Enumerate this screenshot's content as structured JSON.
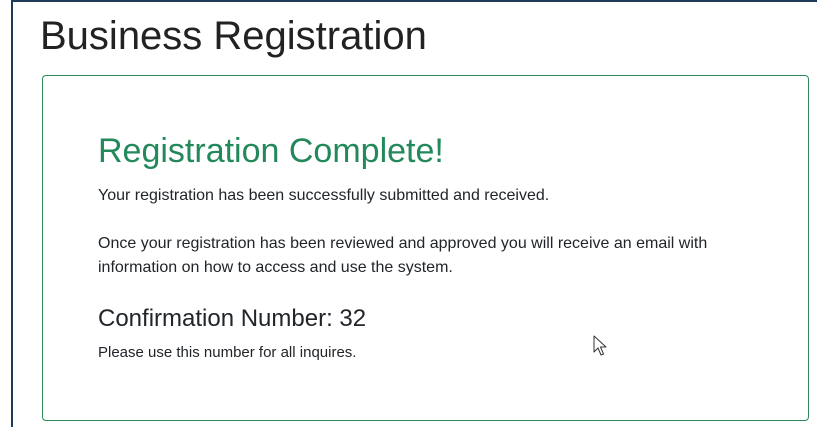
{
  "page": {
    "title": "Business Registration"
  },
  "confirmation_card": {
    "heading": "Registration Complete!",
    "submitted_message": "Your registration has been successfully submitted and received.",
    "review_message": "Once your registration has been reviewed and approved you will receive an email with information on how to access and use the system.",
    "confirmation_label": "Confirmation Number:",
    "confirmation_number": "32",
    "inquiry_note": "Please use this number for all inquires."
  },
  "colors": {
    "accent_green": "#23885a",
    "card_border": "#2e8b57",
    "frame_border": "#1f3b5a"
  },
  "icons": {
    "cursor": "mouse-pointer-icon"
  }
}
